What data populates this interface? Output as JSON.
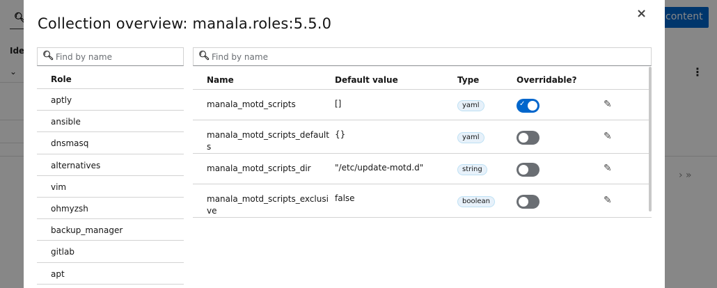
{
  "background": {
    "header_col": "Ide",
    "content_button": "content",
    "pager": "›   »"
  },
  "modal": {
    "title": "Collection overview: manala.roles:5.5.0",
    "close_symbol": "×"
  },
  "roles_panel": {
    "search_placeholder": "Find by name",
    "header": "Role",
    "items": [
      "aptly",
      "ansible",
      "dnsmasq",
      "alternatives",
      "vim",
      "ohmyzsh",
      "backup_manager",
      "gitlab",
      "apt"
    ]
  },
  "vars_panel": {
    "search_placeholder": "Find by name",
    "headers": {
      "name": "Name",
      "default": "Default value",
      "type": "Type",
      "overridable": "Overridable?"
    },
    "rows": [
      {
        "name": "manala_motd_scripts",
        "default": "[]",
        "type": "yaml",
        "overridable": true
      },
      {
        "name": "manala_motd_scripts_defaults",
        "default": "{}",
        "type": "yaml",
        "overridable": false
      },
      {
        "name": "manala_motd_scripts_dir",
        "default": "\"/etc/update-motd.d\"",
        "type": "string",
        "overridable": false
      },
      {
        "name": "manala_motd_scripts_exclusive",
        "default": "false",
        "type": "boolean",
        "overridable": false
      }
    ]
  },
  "icons": {
    "search": "search-icon",
    "close": "close-icon",
    "edit": "pencil-icon",
    "check": "check-icon",
    "kebab": "kebab-icon"
  }
}
